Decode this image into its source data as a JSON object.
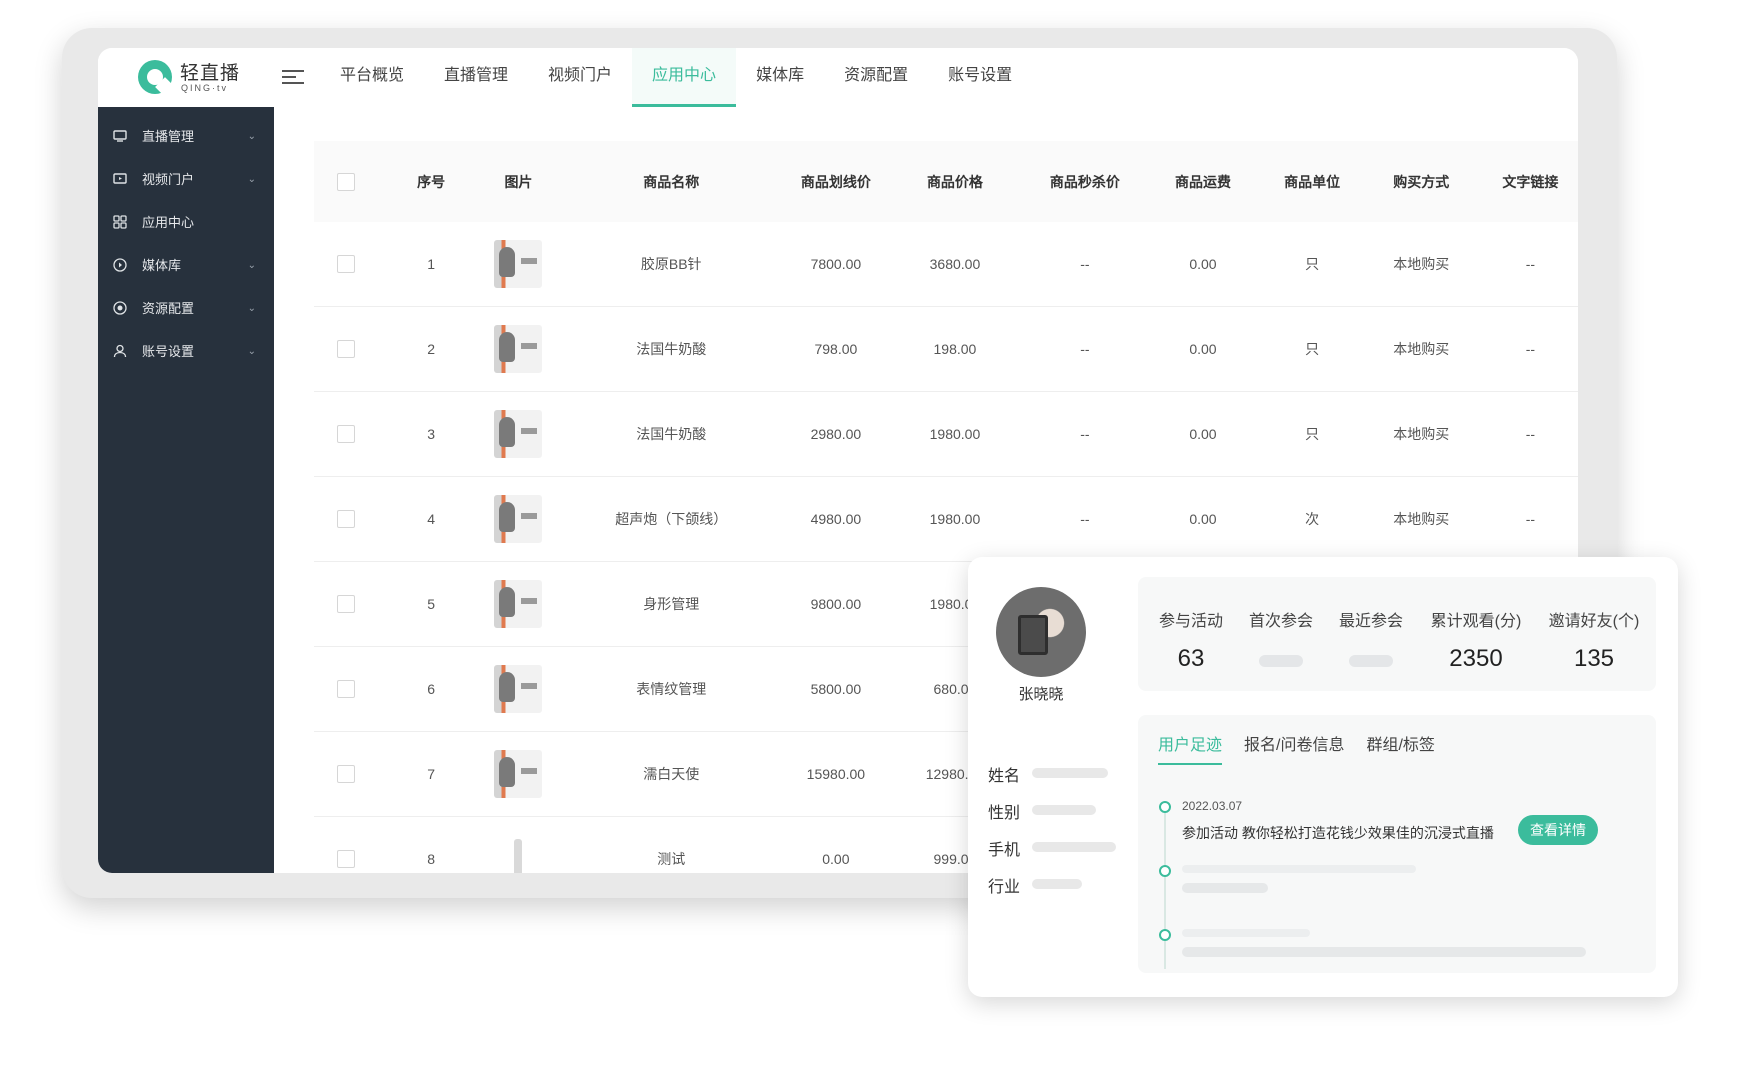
{
  "brand": {
    "name": "轻直播",
    "sub": "QING·tv"
  },
  "nav": [
    "平台概览",
    "直播管理",
    "视频门户",
    "应用中心",
    "媒体库",
    "资源配置",
    "账号设置"
  ],
  "sidebar": [
    {
      "label": "直播管理",
      "icon": "monitor-icon",
      "expandable": true
    },
    {
      "label": "视频门户",
      "icon": "screen-play-icon",
      "expandable": true
    },
    {
      "label": "应用中心",
      "icon": "apps-grid-icon",
      "expandable": false
    },
    {
      "label": "媒体库",
      "icon": "play-circle-icon",
      "expandable": true
    },
    {
      "label": "资源配置",
      "icon": "target-icon",
      "expandable": true
    },
    {
      "label": "账号设置",
      "icon": "user-icon",
      "expandable": true
    }
  ],
  "table": {
    "headers": [
      "序号",
      "图片",
      "商品名称",
      "商品划线价",
      "商品价格",
      "商品秒杀价",
      "商品运费",
      "商品单位",
      "购买方式",
      "文字链接"
    ],
    "rows": [
      {
        "no": "1",
        "name": "胶原BB针",
        "strike": "7800.00",
        "price": "3680.00",
        "flash": "--",
        "ship": "0.00",
        "unit": "只",
        "buy": "本地购买",
        "link": "--"
      },
      {
        "no": "2",
        "name": "法国牛奶酸",
        "strike": "798.00",
        "price": "198.00",
        "flash": "--",
        "ship": "0.00",
        "unit": "只",
        "buy": "本地购买",
        "link": "--"
      },
      {
        "no": "3",
        "name": "法国牛奶酸",
        "strike": "2980.00",
        "price": "1980.00",
        "flash": "--",
        "ship": "0.00",
        "unit": "只",
        "buy": "本地购买",
        "link": "--"
      },
      {
        "no": "4",
        "name": "超声炮（下颌线）",
        "strike": "4980.00",
        "price": "1980.00",
        "flash": "--",
        "ship": "0.00",
        "unit": "次",
        "buy": "本地购买",
        "link": "--"
      },
      {
        "no": "5",
        "name": "身形管理",
        "strike": "9800.00",
        "price": "1980.00",
        "flash": "",
        "ship": "",
        "unit": "",
        "buy": "",
        "link": ""
      },
      {
        "no": "6",
        "name": "表情纹管理",
        "strike": "5800.00",
        "price": "680.00",
        "flash": "",
        "ship": "",
        "unit": "",
        "buy": "",
        "link": ""
      },
      {
        "no": "7",
        "name": "濡白天使",
        "strike": "15980.00",
        "price": "12980.00",
        "flash": "",
        "ship": "",
        "unit": "",
        "buy": "",
        "link": ""
      },
      {
        "no": "8",
        "name": "测试",
        "strike": "0.00",
        "price": "999.00",
        "flash": "",
        "ship": "",
        "unit": "",
        "buy": "",
        "link": ""
      }
    ]
  },
  "profile": {
    "name": "张晓晓",
    "fields": [
      "姓名",
      "性别",
      "手机",
      "行业"
    ],
    "stats": [
      {
        "label": "参与活动",
        "value": "63"
      },
      {
        "label": "首次参会",
        "value": ""
      },
      {
        "label": "最近参会",
        "value": ""
      },
      {
        "label": "累计观看(分)",
        "value": "2350"
      },
      {
        "label": "邀请好友(个)",
        "value": "135"
      }
    ],
    "tabs": [
      "用户足迹",
      "报名/问卷信息",
      "群组/标签"
    ],
    "timeline": {
      "date": "2022.03.07",
      "activity": "参加活动 教你轻松打造花钱少效果佳的沉浸式直播",
      "button": "查看详情"
    }
  },
  "colors": {
    "accent": "#3bbc9c",
    "sidebar": "#27313d"
  }
}
